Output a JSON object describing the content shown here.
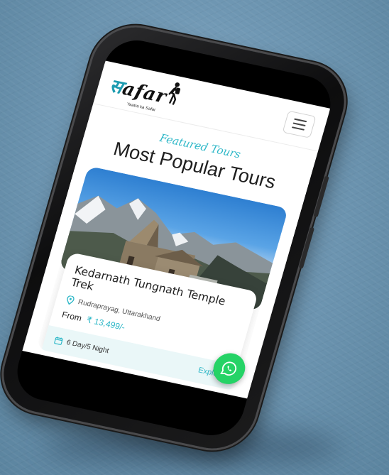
{
  "brand": {
    "logo_text": "afar",
    "logo_first_glyph": "स",
    "tagline": "Yaatra ka Safar",
    "accent_color": "#2fb8c8"
  },
  "header": {
    "menu_icon": "hamburger-icon"
  },
  "section": {
    "kicker": "Featured Tours",
    "heading": "Most Popular Tours"
  },
  "tour_card": {
    "title": "Kedarnath Tungnath Temple Trek",
    "location": "Rudraprayag, Uttarakhand",
    "price_prefix": "From",
    "price": "₹ 13,499/-",
    "duration": "6 Day/5 Night",
    "cta": "Explore",
    "location_icon": "map-pin-icon",
    "duration_icon": "calendar-icon"
  },
  "floating": {
    "whatsapp_icon": "whatsapp-icon",
    "color": "#25d366"
  }
}
